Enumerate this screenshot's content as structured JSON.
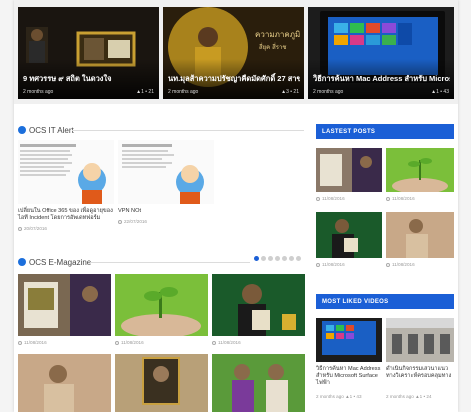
{
  "hero": [
    {
      "title": "9 ทศวรรษ ๙ สถิต ในดวงใจ",
      "time": "2 months ago",
      "stats": "▲1 • 21"
    },
    {
      "title": "นท.มุลส้าความปรัชญาคืดมัดศักดิ์ 27 สาข",
      "time": "2 months ago",
      "stats": "▲3 • 21"
    },
    {
      "title": "วิธีการค้นหา Mac Address สำหรับ Microsoft",
      "time": "2 months ago",
      "stats": "▲1 • 43"
    }
  ],
  "ocs_alert": {
    "heading": "OCS IT Alert",
    "items": [
      {
        "caption": "เปลี่ยนใน Office 365 ของ เพื่อดูอายุของ ไอที Incident โดยการอัพเดทฟอร์ม",
        "date": "20/07/2016"
      },
      {
        "caption": "VPN NOt",
        "date": "22/07/2016"
      }
    ]
  },
  "magazine": {
    "heading": "OCS E-Magazine",
    "dates": [
      "11/08/2016",
      "11/08/2016",
      "11/08/2016"
    ]
  },
  "latest_posts": {
    "heading": "LASTEST POSTS",
    "dates": [
      "11/08/2016",
      "11/08/2016",
      "11/08/2016",
      "11/08/2016"
    ]
  },
  "liked": {
    "heading": "MOST LIKED VIDEOS",
    "items": [
      {
        "caption": "วิธีการค้นหา Mac Address สำหรับ Microsoft Surface ไฟฟ้า",
        "time": "2 months ago",
        "stats": "▲1 • 43"
      },
      {
        "caption": "ดำเนินกิจกรรมเสวนาแนว ทางวิเคราะห์ครอบคลุมทาง",
        "time": "2 months ago",
        "stats": "▲1 • 24"
      }
    ]
  },
  "colors": {
    "accent": "#1b5fd6"
  }
}
